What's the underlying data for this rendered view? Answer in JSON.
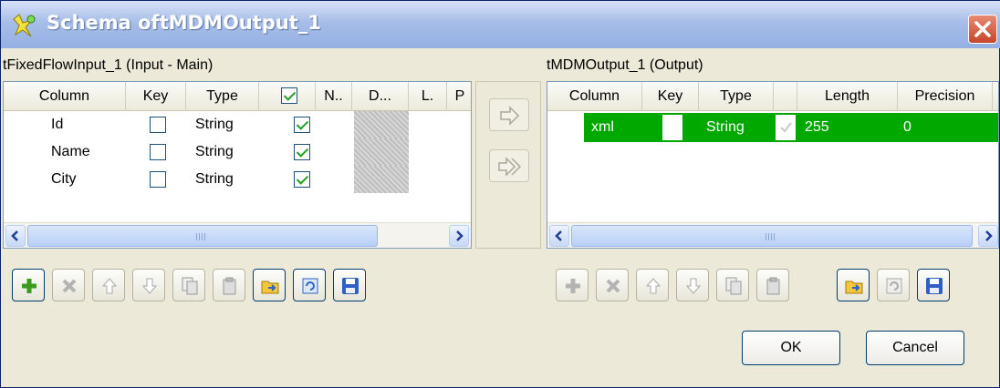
{
  "window": {
    "title": "Schema oftMDMOutput_1",
    "close_icon": "close-x-icon"
  },
  "left_panel": {
    "label": "tFixedFlowInput_1 (Input - Main)",
    "columns": [
      "Column",
      "Key",
      "Type",
      "N..",
      "D...",
      "L.",
      "P"
    ],
    "rows": [
      {
        "column": "Id",
        "key": false,
        "type": "String",
        "nullable": true
      },
      {
        "column": "Name",
        "key": false,
        "type": "String",
        "nullable": true
      },
      {
        "column": "City",
        "key": false,
        "type": "String",
        "nullable": true
      }
    ]
  },
  "right_panel": {
    "label": "tMDMOutput_1 (Output)",
    "columns": [
      "Column",
      "Key",
      "Type",
      "",
      "Length",
      "Precision"
    ],
    "rows": [
      {
        "column": "xml",
        "key": false,
        "type": "String",
        "nullable": true,
        "length": "255",
        "precision": "0",
        "highlight": "#00a800"
      }
    ]
  },
  "middle_buttons": [
    "copy-selected-arrow-icon",
    "copy-all-arrow-icon"
  ],
  "toolbar_icons": [
    "add-icon",
    "remove-icon",
    "move-up-icon",
    "move-down-icon",
    "copy-icon",
    "paste-icon",
    "import-icon",
    "export-icon",
    "save-icon"
  ],
  "buttons": {
    "ok": "OK",
    "cancel": "Cancel"
  },
  "colors": {
    "title_bar": "#a7bde8",
    "highlight_row": "#00a800",
    "checkbox_check": "#21a121"
  }
}
